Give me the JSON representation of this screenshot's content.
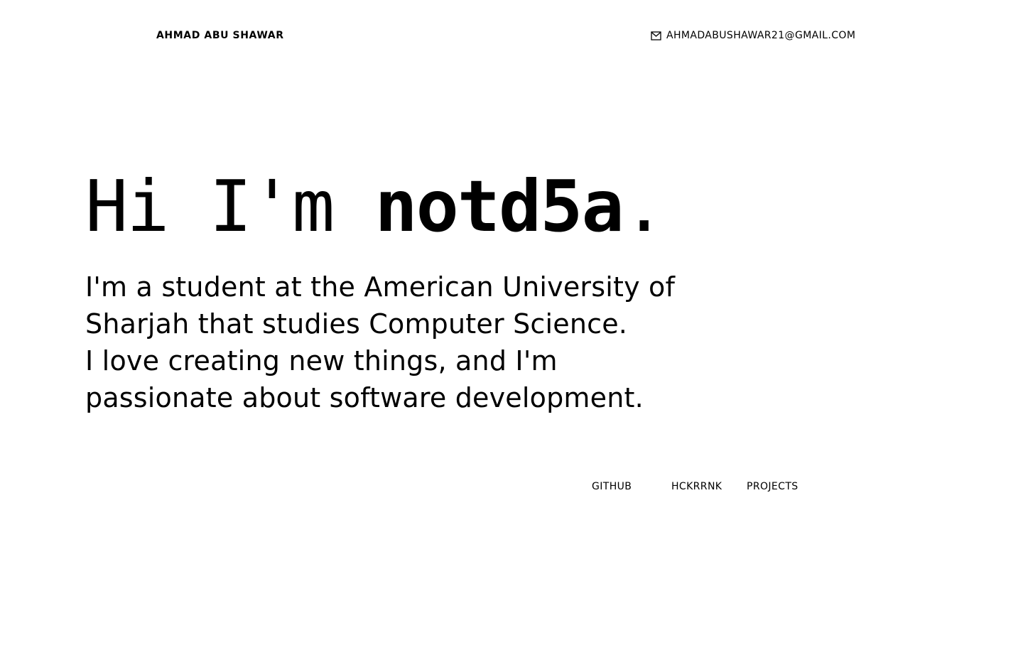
{
  "header": {
    "brand": "AHMAD ABU SHAWAR",
    "email": "AHMADABUSHAWAR21@GMAIL.COM",
    "email_icon": "mail-icon"
  },
  "hero": {
    "greeting": "Hi I'm ",
    "handle": "notd5a",
    "period": "."
  },
  "bio": {
    "lines": [
      "I'm a student at the American University of",
      "Sharjah that studies Computer Science.",
      "I love creating new things, and I'm",
      "passionate about software development."
    ]
  },
  "links": {
    "github": "GITHUB",
    "hackerrank": "HCKRRNK",
    "projects": "PROJECTS"
  }
}
